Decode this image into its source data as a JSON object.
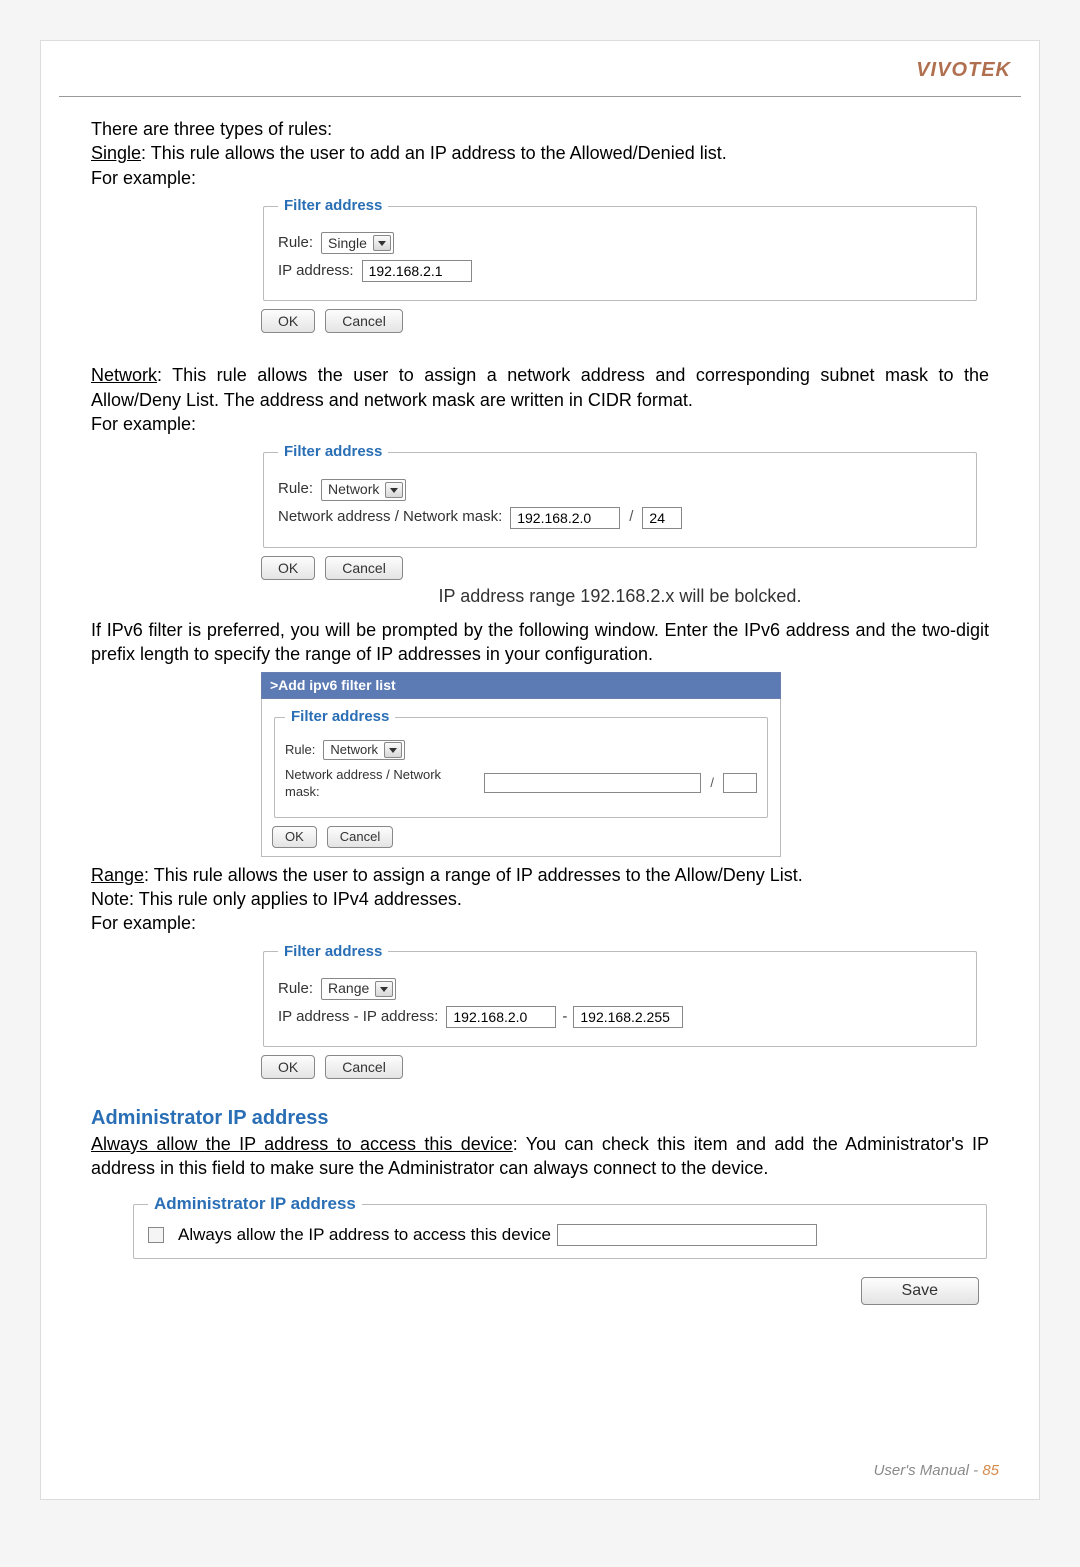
{
  "brand": "VIVOTEK",
  "intro": {
    "line1": "There are three types of rules:",
    "single_label": "Single",
    "single_rest": ": This rule allows the user to add an IP address to the Allowed/Denied list.",
    "forex": "For example:"
  },
  "single": {
    "legend": "Filter address",
    "rule_label": "Rule:",
    "rule_value": "Single",
    "ip_label": "IP address:",
    "ip_value": "192.168.2.1",
    "ok": "OK",
    "cancel": "Cancel"
  },
  "network_text": {
    "net_label": "Network",
    "net_rest": ": This rule allows the user to assign a network address and corresponding subnet mask to the Allow/Deny List. The address and network mask are written in CIDR format.",
    "forex": "For example:"
  },
  "network": {
    "legend": "Filter address",
    "rule_label": "Rule:",
    "rule_value": "Network",
    "addr_label": "Network address / Network mask:",
    "addr_value": "192.168.2.0",
    "mask_value": "24",
    "ok": "OK",
    "cancel": "Cancel",
    "note": "IP address range 192.168.2.x will be bolcked."
  },
  "ipv6_text": "If IPv6 filter is preferred, you will be prompted by the following window. Enter the IPv6 address and the two-digit prefix length to specify the range of IP addresses in your configuration.",
  "ipv6": {
    "header": ">Add ipv6 filter list",
    "legend": "Filter address",
    "rule_label": "Rule:",
    "rule_value": "Network",
    "addr_label": "Network address / Network mask:",
    "ok": "OK",
    "cancel": "Cancel"
  },
  "range_text": {
    "range_label": "Range",
    "range_rest": ": This rule allows the user to assign a range of IP addresses to the Allow/Deny List.",
    "note": "Note: This rule only applies to IPv4 addresses.",
    "forex": "For example:"
  },
  "range": {
    "legend": "Filter address",
    "rule_label": "Rule:",
    "rule_value": "Range",
    "addr_label": "IP address - IP address:",
    "from_value": "192.168.2.0",
    "to_value": "192.168.2.255",
    "ok": "OK",
    "cancel": "Cancel"
  },
  "admin": {
    "heading": "Administrator IP address",
    "always_label_u": "Always allow the IP address to access this device",
    "always_rest": ": You can check this item and add the Administrator's IP address in this field to make sure the Administrator can always connect to the device.",
    "legend": "Administrator IP address",
    "cb_label": "Always allow the IP address to access this device",
    "save": "Save"
  },
  "footer": {
    "label": "User's Manual - ",
    "page": "85"
  }
}
